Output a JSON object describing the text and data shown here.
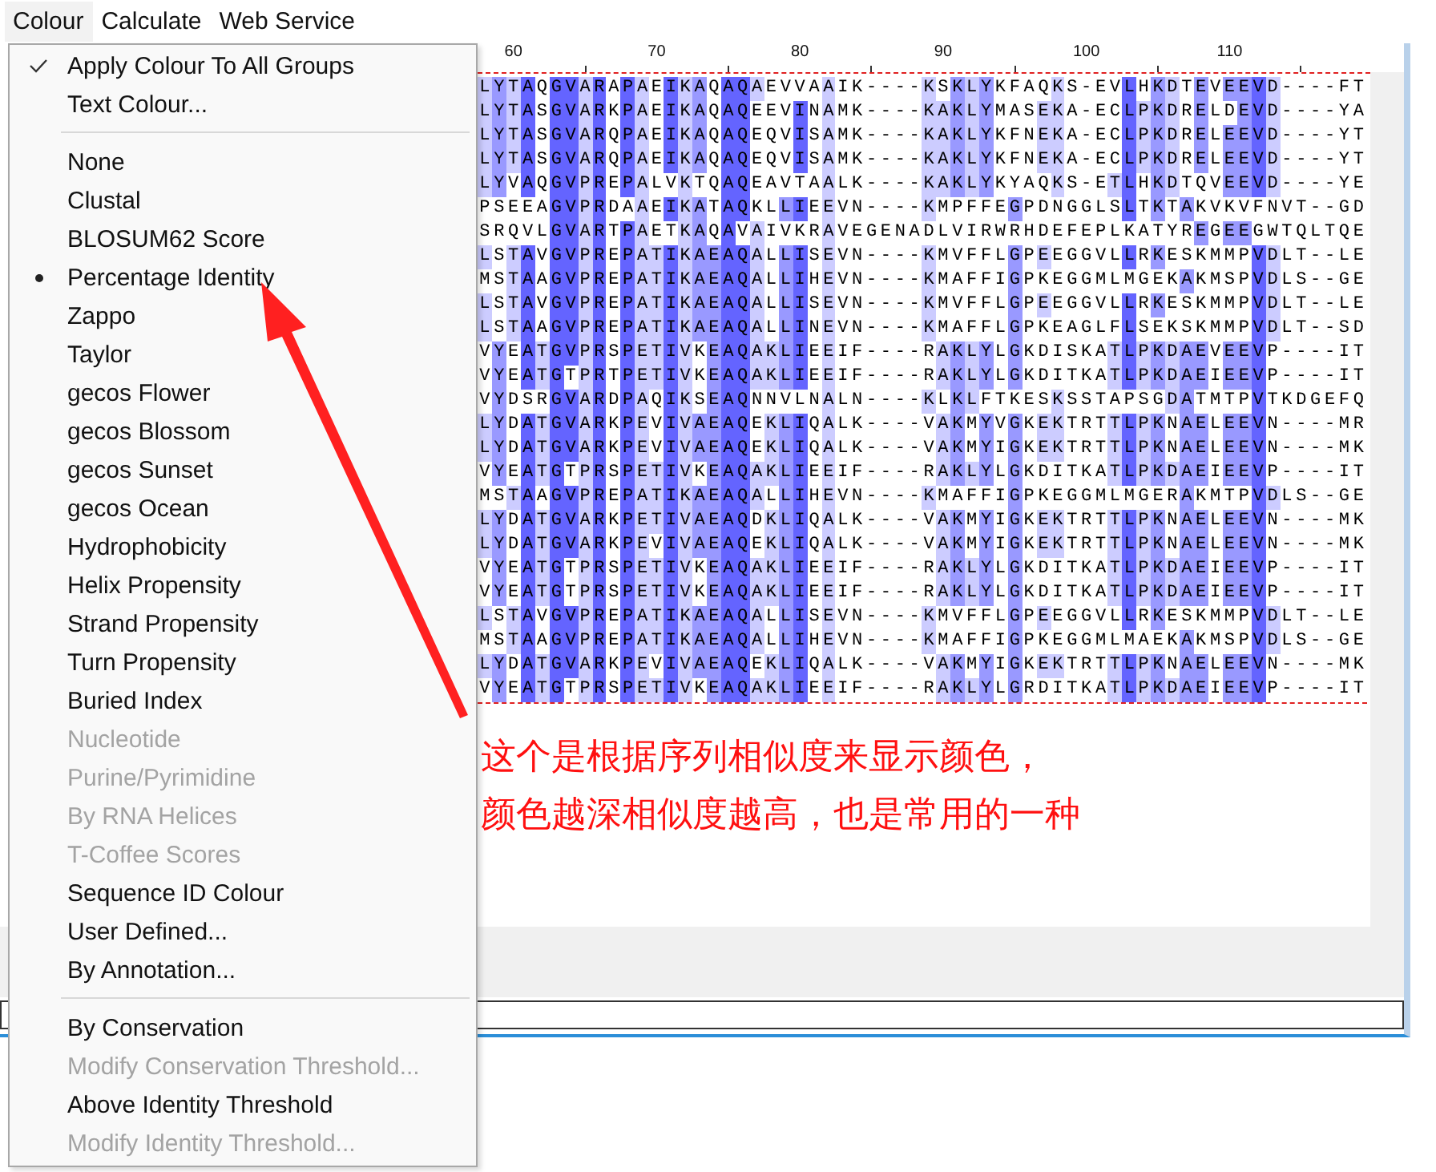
{
  "menubar": [
    {
      "label": "Colour",
      "selected": true
    },
    {
      "label": "Calculate",
      "selected": false
    },
    {
      "label": "Web Service",
      "selected": false
    }
  ],
  "ruler": [
    "60",
    "70",
    "80",
    "90",
    "100",
    "110"
  ],
  "sequences": [
    "LYTAQGVARAPAEIKAQAQAEVVAAIK----KSKLYKFAQKS-EVLHKDTEVEEVD----FT",
    "LYTASGVARKPAEIKAQAQEEVINAMK----KAKLYMASEKA-ECLPKDRELDEVD----YA",
    "LYTASGVARQPAEIKAQAQEQVISAMK----KAKLYKFNEKA-ECLPKDRELEEVD----YT",
    "LYTASGVARQPAEIKAQAQEQVISAMK----KAKLYKFNEKA-ECLPKDRELEEVD----YT",
    "LYVAQGVPREPALVKTQAQEAVTAALK----KAKLYKYAQKS-ETLHKDTQVEEVD----YE",
    "PSEEAGVPRDAAEIKATAQKLLIEEVN----KMPFFEGPDNGGLSLTKTAKVKVFNVT--GD",
    "SRQVLGVARTPAETKAQAVAIVKRAVEGENADLVIRWRHDEFEPLKATYREGEEGWTQLTQE",
    "LSTAVGVPREPATIKAEAQALLISEVN----KMVFFLGPEEGGVLLRKESKMMPVDLT--LE",
    "MSTAAGVPREPATIKAEAQALLIHEVN----KMAFFIGPKEGGMLMGEKAKMSPVDLS--GE",
    "LSTAVGVPREPATIKAEAQALLISEVN----KMVFFLGPEEGGVLLRKESKMMPVDLT--LE",
    "LSTAAGVPREPATIKAEAQALLINEVN----KMAFFLGPKEAGLFLSEKSKMMPVDLT--SD",
    "VYEATGVPRSPETIVKEAQAKLIEEIF----RAKLYLGKDISKATLPKDAEVEEVP----IT",
    "VYEATGTPRTPETIVKEAQAKLIEEIF----RAKLYLGKDITKATLPKDAEIEEVP----IT",
    "VYDSRGVARDPAQIKSEAQNNVLNALN----KLKLFTKESKSSTAPSGDATMTPVTKDGEFQ",
    "LYDATGVARKPEVIVAEAQEKLIQALK----VAKMYVGKEKTRTTLPKNAELEEVN----MR",
    "LYDATGVARKPEVIVAEAQEKLIQALK----VAKMYIGKEKTRTTLPKNAELEEVN----MK",
    "VYEATGTPRSPETIVKEAQAKLIEEIF----RAKLYLGKDITKATLPKDAEIEEVP----IT",
    "MSTAAGVPREPATIKAEAQALLIHEVN----KMAFFIGPKEGGMLMGERAKMTPVDLS--GE",
    "LYDATGVARKPETIVAEAQDKLIQALK----VAKMYIGKEKTRTTLPKNAELEEVN----MK",
    "LYDATGVARKPEVIVAEAQEKLIQALK----VAKMYIGKEKTRTTLPKNAELEEVN----MK",
    "VYEATGTPRSPETIVKEAQAKLIEEIF----RAKLYLGKDITKATLPKDAEIEEVP----IT",
    "VYEATGTPRSPETIVKEAQAKLIEEIF----RAKLYLGKDITKATLPKDAEIEEVP----IT",
    "LSTAVGVPREPATIKAEAQALLISEVN----KMVFFLGPEEGGVLLRKESKMMPVDLT--LE",
    "MSTAAGVPREPATIKAEAQALLIHEVN----KMAFFIGPKEGGMLMAEKAKMSPVDLS--GE",
    "LYDATGVARKPEVIVAEAQEKLIQALK----VAKMYIGKEKTRTTLPKNAELEEVN----MK",
    "VYEATGTPRSPETIVKEAQAKLIEEIF----RAKLYLGRDITKATLPKDAEIEEVP----IT"
  ],
  "menu": {
    "sections": [
      [
        {
          "label": "Apply Colour To All Groups",
          "kind": "check",
          "checked": true,
          "disabled": false
        },
        {
          "label": "Text Colour...",
          "kind": "action",
          "disabled": false
        }
      ],
      [
        {
          "label": "None",
          "kind": "radio",
          "selected": false,
          "disabled": false
        },
        {
          "label": "Clustal",
          "kind": "radio",
          "selected": false,
          "disabled": false
        },
        {
          "label": "BLOSUM62 Score",
          "kind": "radio",
          "selected": false,
          "disabled": false
        },
        {
          "label": "Percentage Identity",
          "kind": "radio",
          "selected": true,
          "disabled": false
        },
        {
          "label": "Zappo",
          "kind": "radio",
          "selected": false,
          "disabled": false
        },
        {
          "label": "Taylor",
          "kind": "radio",
          "selected": false,
          "disabled": false
        },
        {
          "label": "gecos Flower",
          "kind": "radio",
          "selected": false,
          "disabled": false
        },
        {
          "label": "gecos Blossom",
          "kind": "radio",
          "selected": false,
          "disabled": false
        },
        {
          "label": "gecos Sunset",
          "kind": "radio",
          "selected": false,
          "disabled": false
        },
        {
          "label": "gecos Ocean",
          "kind": "radio",
          "selected": false,
          "disabled": false
        },
        {
          "label": "Hydrophobicity",
          "kind": "radio",
          "selected": false,
          "disabled": false
        },
        {
          "label": "Helix Propensity",
          "kind": "radio",
          "selected": false,
          "disabled": false
        },
        {
          "label": "Strand Propensity",
          "kind": "radio",
          "selected": false,
          "disabled": false
        },
        {
          "label": "Turn Propensity",
          "kind": "radio",
          "selected": false,
          "disabled": false
        },
        {
          "label": "Buried Index",
          "kind": "radio",
          "selected": false,
          "disabled": false
        },
        {
          "label": "Nucleotide",
          "kind": "radio",
          "selected": false,
          "disabled": true
        },
        {
          "label": "Purine/Pyrimidine",
          "kind": "radio",
          "selected": false,
          "disabled": true
        },
        {
          "label": "By RNA Helices",
          "kind": "radio",
          "selected": false,
          "disabled": true
        },
        {
          "label": "T-Coffee Scores",
          "kind": "radio",
          "selected": false,
          "disabled": true
        },
        {
          "label": "Sequence ID Colour",
          "kind": "radio",
          "selected": false,
          "disabled": false
        },
        {
          "label": "User Defined...",
          "kind": "radio",
          "selected": false,
          "disabled": false
        },
        {
          "label": "By Annotation...",
          "kind": "radio",
          "selected": false,
          "disabled": false
        }
      ],
      [
        {
          "label": "By Conservation",
          "kind": "check",
          "checked": false,
          "disabled": false
        },
        {
          "label": "Modify Conservation Threshold...",
          "kind": "action",
          "disabled": true
        },
        {
          "label": "Above Identity Threshold",
          "kind": "check",
          "checked": false,
          "disabled": false
        },
        {
          "label": "Modify Identity Threshold...",
          "kind": "action",
          "disabled": true
        }
      ]
    ]
  },
  "annotation": {
    "lines": [
      "这个是根据序列相似度来显示颜色，",
      "颜色越深相似度越高，也是常用的一种"
    ]
  }
}
